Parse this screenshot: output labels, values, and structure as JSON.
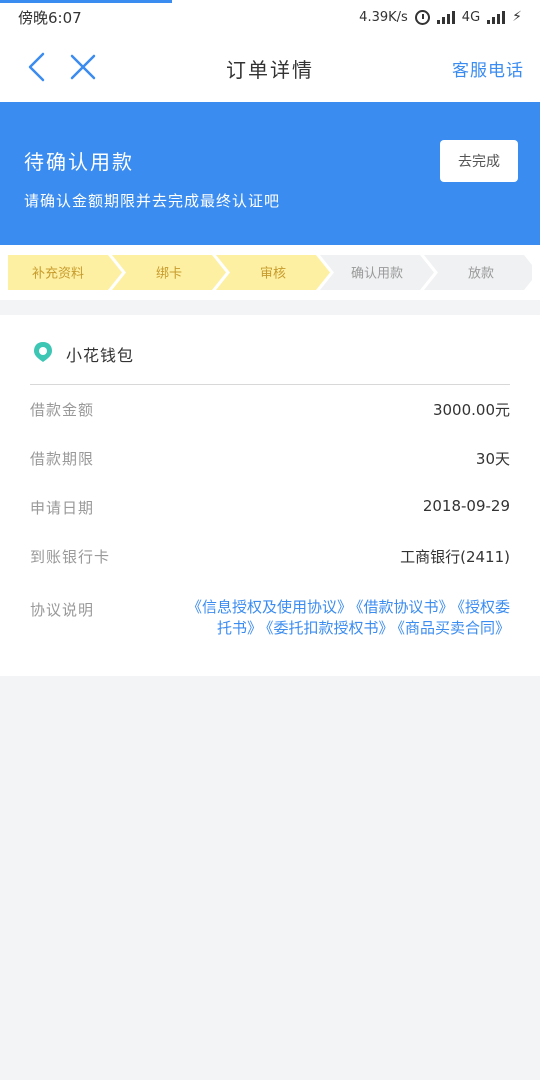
{
  "status_bar": {
    "time": "傍晚6:07",
    "network_speed": "4.39K/s",
    "network_type": "4G"
  },
  "header": {
    "title": "订单详情",
    "customer_service": "客服电话"
  },
  "banner": {
    "title": "待确认用款",
    "subtitle": "请确认金额期限并去完成最终认证吧",
    "button": "去完成"
  },
  "steps": [
    {
      "label": "补充资料",
      "state": "done"
    },
    {
      "label": "绑卡",
      "state": "done"
    },
    {
      "label": "审核",
      "state": "done"
    },
    {
      "label": "确认用款",
      "state": "pending"
    },
    {
      "label": "放款",
      "state": "pending"
    }
  ],
  "colors": {
    "accent": "#3b8cf0",
    "step_done": "#fdf0a3",
    "step_pending": "#f0f1f3",
    "bank_icon": "#3cc6b4"
  },
  "card": {
    "bank_name": "小花钱包",
    "rows": [
      {
        "label": "借款金额",
        "value": "3000.00元"
      },
      {
        "label": "借款期限",
        "value": "30天"
      },
      {
        "label": "申请日期",
        "value": "2018-09-29"
      },
      {
        "label": "到账银行卡",
        "value": "工商银行(2411)"
      }
    ],
    "agreement_label": "协议说明",
    "agreements": [
      "《信息授权及使用协议》",
      "《借款协议书》",
      "《授权委托书》",
      "《委托扣款授权书》",
      "《商品买卖合同》"
    ]
  }
}
